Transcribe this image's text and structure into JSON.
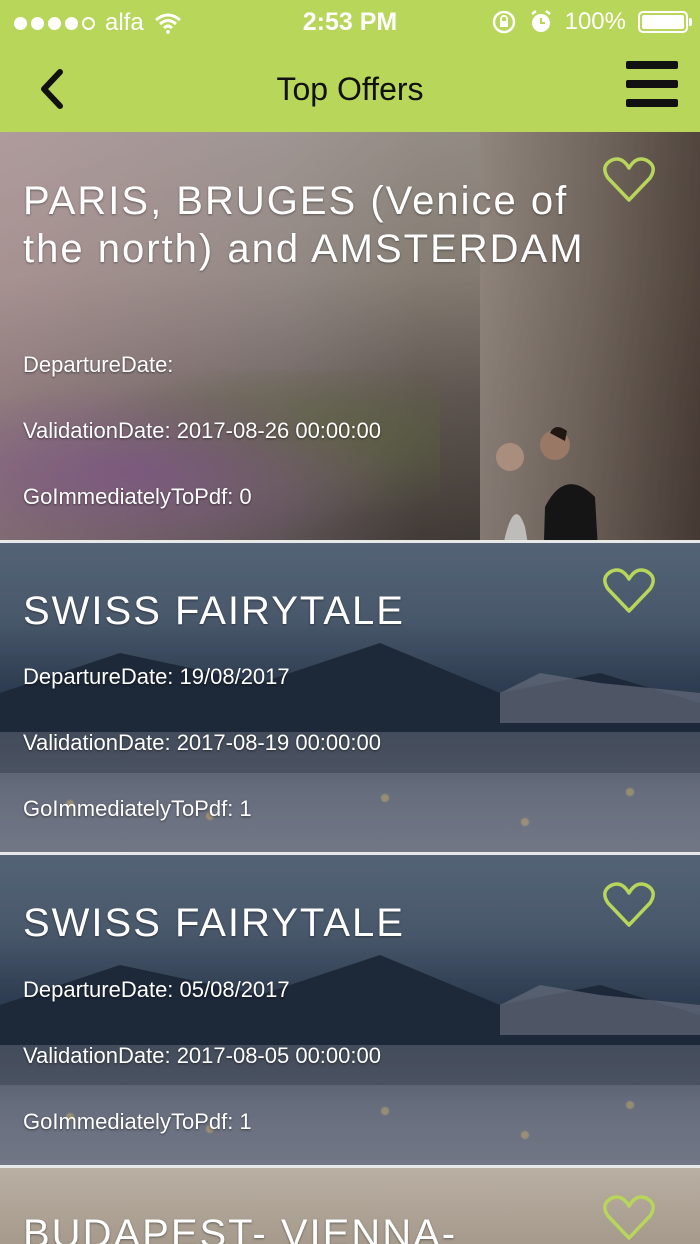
{
  "status_bar": {
    "carrier": "alfa",
    "time": "2:53 PM",
    "battery": "100%",
    "battery_level": 1.0
  },
  "nav": {
    "title": "Top Offers"
  },
  "offers": [
    {
      "title": "PARIS, BRUGES (Venice of the north) and AMSTERDAM",
      "departure": "DepartureDate:",
      "validation": "ValidationDate: 2017-08-26 00:00:00",
      "pdf": "GoImmediatelyToPdf: 0"
    },
    {
      "title": "SWISS FAIRYTALE",
      "departure": "DepartureDate: 19/08/2017",
      "validation": "ValidationDate: 2017-08-19 00:00:00",
      "pdf": "GoImmediatelyToPdf: 1"
    },
    {
      "title": "SWISS FAIRYTALE",
      "departure": "DepartureDate: 05/08/2017",
      "validation": "ValidationDate: 2017-08-05 00:00:00",
      "pdf": "GoImmediatelyToPdf: 1"
    },
    {
      "title": "BUDAPEST- VIENNA-"
    }
  ],
  "colors": {
    "accent": "#b7d65a",
    "heart": "#b7d65a"
  },
  "icons": [
    "back-chevron-icon",
    "hamburger-menu-icon",
    "heart-icon",
    "wifi-icon",
    "alarm-icon",
    "rotation-lock-icon",
    "battery-icon",
    "signal-dots-icon"
  ]
}
